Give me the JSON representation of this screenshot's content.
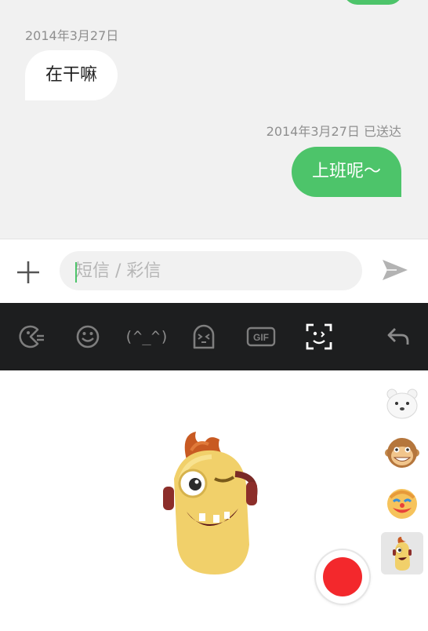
{
  "chat": {
    "messages": [
      {
        "direction": "incoming",
        "timestamp": "2014年3月27日",
        "text": "在干嘛"
      },
      {
        "direction": "outgoing",
        "timestamp": "2014年3月27日  已送达",
        "text": "上班呢～"
      }
    ]
  },
  "composer": {
    "placeholder": "短信 / 彩信",
    "value": "",
    "attach_icon": "plus-icon",
    "send_icon": "send-icon"
  },
  "emoji_bar": {
    "items": [
      {
        "name": "sticker-pack-icon"
      },
      {
        "name": "smiley-icon"
      },
      {
        "name": "kaomoji-tab",
        "text": "(^_^)"
      },
      {
        "name": "ghost-face-icon"
      },
      {
        "name": "gif-icon",
        "text": "GIF"
      },
      {
        "name": "face-scan-icon",
        "selected": true
      },
      {
        "name": "back-icon"
      }
    ]
  },
  "animoji_panel": {
    "avatars": [
      {
        "name": "polar-bear",
        "selected": false
      },
      {
        "name": "monkey",
        "selected": false
      },
      {
        "name": "clown",
        "selected": false
      },
      {
        "name": "one-eyed-character",
        "selected": true
      }
    ],
    "record_icon": "record-button"
  },
  "colors": {
    "accent_green": "#4dc46a",
    "chat_bg": "#f1f1f1",
    "toolbar_bg": "#1d1e1f",
    "record_red": "#f3282c"
  }
}
